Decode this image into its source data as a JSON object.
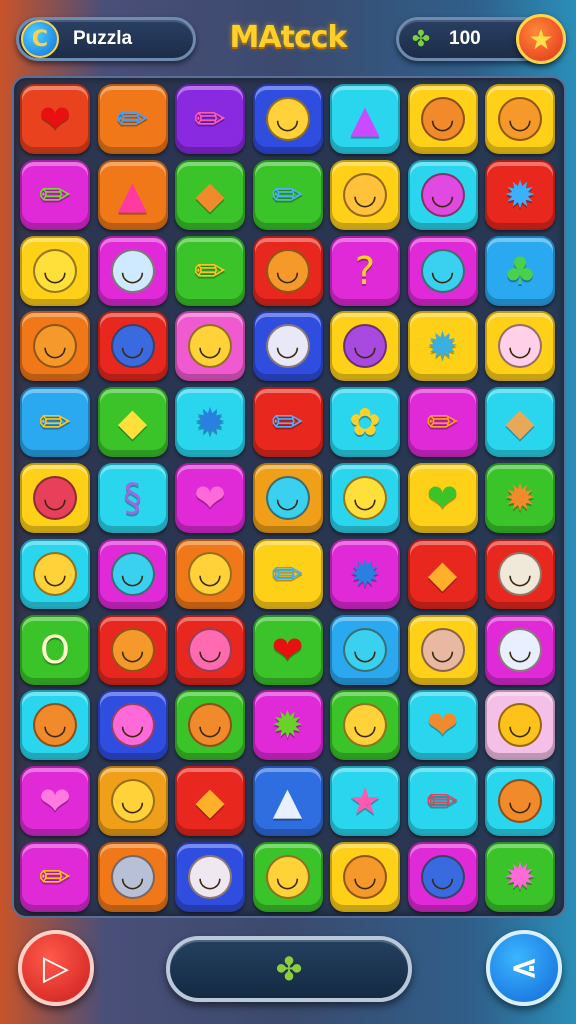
{
  "header": {
    "left_label": "Puzzla",
    "left_icon": "c-coin-icon",
    "title": "MAtcck",
    "score": "100",
    "score_icon": "clover-icon",
    "star_icon": "star-icon"
  },
  "board": {
    "rows": [
      [
        {
          "bg": "#e8421e",
          "icon": "heart-icon",
          "glyph": "❤",
          "color": "#e81010"
        },
        {
          "bg": "#f07818",
          "icon": "pencil-icon",
          "glyph": "✏",
          "color": "#3fa0ff"
        },
        {
          "bg": "#8a2ae0",
          "icon": "pencil-icon",
          "glyph": "✏",
          "color": "#ff5ab0"
        },
        {
          "bg": "#2f4ee0",
          "icon": "smiley-face-icon",
          "face": true,
          "faceColor": "#ffd23a",
          "glyph": "◡"
        },
        {
          "bg": "#2ad6ee",
          "icon": "triangle-icon",
          "glyph": "▲",
          "color": "#c94aff"
        },
        {
          "bg": "#ffd018",
          "icon": "cat-face-icon",
          "face": true,
          "faceColor": "#f08a2a",
          "glyph": "◡"
        },
        {
          "bg": "#ffd018",
          "icon": "cat-face-icon",
          "face": true,
          "faceColor": "#f59a2a",
          "glyph": "◡"
        }
      ],
      [
        {
          "bg": "#e02ad8",
          "icon": "pencil-icon",
          "glyph": "✏",
          "color": "#7ad33a"
        },
        {
          "bg": "#f07818",
          "icon": "drop-icon",
          "glyph": "▲",
          "color": "#ff3aa0"
        },
        {
          "bg": "#3ac42a",
          "icon": "leaf-icon",
          "glyph": "◆",
          "color": "#f08a2a"
        },
        {
          "bg": "#3ac42a",
          "icon": "pencil-icon",
          "glyph": "✏",
          "color": "#4ab0ff"
        },
        {
          "bg": "#ffd018",
          "icon": "bear-face-icon",
          "face": true,
          "faceColor": "#ffc23a",
          "glyph": "◡"
        },
        {
          "bg": "#2ad6ee",
          "icon": "monster-face-icon",
          "face": true,
          "faceColor": "#e04ae0",
          "glyph": "◡"
        },
        {
          "bg": "#e8281e",
          "icon": "splat-icon",
          "glyph": "✹",
          "color": "#3ab0ff"
        }
      ],
      [
        {
          "bg": "#ffd018",
          "icon": "lemon-face-icon",
          "face": true,
          "faceColor": "#ffe03a",
          "glyph": "◡"
        },
        {
          "bg": "#e02ad8",
          "icon": "egg-face-icon",
          "face": true,
          "faceColor": "#cfeaff",
          "glyph": "◡"
        },
        {
          "bg": "#3ac42a",
          "icon": "pencil-icon",
          "glyph": "✏",
          "color": "#ffc21a"
        },
        {
          "bg": "#e8281e",
          "icon": "cat-face-icon",
          "face": true,
          "faceColor": "#f59a2a",
          "glyph": "◡"
        },
        {
          "bg": "#e02ad8",
          "icon": "question-icon",
          "glyph": "?",
          "color": "#ffd02a"
        },
        {
          "bg": "#e02ad8",
          "icon": "smiley-face-icon",
          "face": true,
          "faceColor": "#3ad0f0",
          "glyph": "◡"
        },
        {
          "bg": "#2aa8f0",
          "icon": "leaf-icon",
          "glyph": "♣",
          "color": "#4ad04a"
        }
      ],
      [
        {
          "bg": "#f07818",
          "icon": "cat-face-icon",
          "face": true,
          "faceColor": "#f59a2a",
          "glyph": "◡"
        },
        {
          "bg": "#e8281e",
          "icon": "blob-face-icon",
          "face": true,
          "faceColor": "#3a6ae0",
          "glyph": "◡"
        },
        {
          "bg": "#f05ad0",
          "icon": "smiley-face-icon",
          "face": true,
          "faceColor": "#ffd23a",
          "glyph": "◡"
        },
        {
          "bg": "#2f4ee0",
          "icon": "sunglasses-face-icon",
          "face": true,
          "faceColor": "#e8e8f8",
          "glyph": "◡"
        },
        {
          "bg": "#ffd018",
          "icon": "cat-face-icon",
          "face": true,
          "faceColor": "#a84ae0",
          "glyph": "◡"
        },
        {
          "bg": "#ffd018",
          "icon": "splat-icon",
          "glyph": "✹",
          "color": "#3ab0e0"
        },
        {
          "bg": "#ffd018",
          "icon": "cat-face-icon",
          "face": true,
          "faceColor": "#ffd0e8",
          "glyph": "◡"
        }
      ],
      [
        {
          "bg": "#2aa8f0",
          "icon": "pencil-icon",
          "glyph": "✏",
          "color": "#ffc21a"
        },
        {
          "bg": "#3ac42a",
          "icon": "leaf-icon",
          "glyph": "◆",
          "color": "#ffe03a"
        },
        {
          "bg": "#2ad6ee",
          "icon": "splat-icon",
          "glyph": "✹",
          "color": "#2a80e0"
        },
        {
          "bg": "#e8281e",
          "icon": "pencil-icon",
          "glyph": "✏",
          "color": "#4ab0ff"
        },
        {
          "bg": "#2ad6ee",
          "icon": "flower-icon",
          "glyph": "✿",
          "color": "#ffd02a"
        },
        {
          "bg": "#e02ad8",
          "icon": "pencil-icon",
          "glyph": "✏",
          "color": "#ffa01a"
        },
        {
          "bg": "#2ad6ee",
          "icon": "sign-icon",
          "glyph": "◆",
          "color": "#e8a85a"
        }
      ],
      [
        {
          "bg": "#ffd018",
          "icon": "monster-face-icon",
          "face": true,
          "faceColor": "#e8405a",
          "glyph": "◡"
        },
        {
          "bg": "#2ad6ee",
          "icon": "scroll-icon",
          "glyph": "§",
          "color": "#9a6ae0"
        },
        {
          "bg": "#e02ad8",
          "icon": "heart-icon",
          "glyph": "❤",
          "color": "#ff6ad8"
        },
        {
          "bg": "#f0a018",
          "icon": "smiley-face-icon",
          "face": true,
          "faceColor": "#3ad0f0",
          "glyph": "◡"
        },
        {
          "bg": "#2ad6ee",
          "icon": "cat-face-icon",
          "face": true,
          "faceColor": "#ffe03a",
          "glyph": "◡"
        },
        {
          "bg": "#ffd018",
          "icon": "heart-icon",
          "glyph": "❤",
          "color": "#3ac42a"
        },
        {
          "bg": "#3ac42a",
          "icon": "splat-icon",
          "glyph": "✹",
          "color": "#f08a2a"
        }
      ],
      [
        {
          "bg": "#2ad6ee",
          "icon": "smiley-face-icon",
          "face": true,
          "faceColor": "#ffd23a",
          "glyph": "◡"
        },
        {
          "bg": "#e02ad8",
          "icon": "smiley-face-icon",
          "face": true,
          "faceColor": "#3ad0f0",
          "glyph": "◡"
        },
        {
          "bg": "#f07818",
          "icon": "smiley-face-icon",
          "face": true,
          "faceColor": "#ffd23a",
          "glyph": "◡"
        },
        {
          "bg": "#ffd018",
          "icon": "pencil-icon",
          "glyph": "✏",
          "color": "#3ab0ff"
        },
        {
          "bg": "#e02ad8",
          "icon": "splat-icon",
          "glyph": "✹",
          "color": "#2a80e0"
        },
        {
          "bg": "#e8281e",
          "icon": "balloon-icon",
          "glyph": "◆",
          "color": "#ffb02a"
        },
        {
          "bg": "#e8281e",
          "icon": "sunglasses-face-icon",
          "face": true,
          "faceColor": "#f0e8d8",
          "glyph": "◡"
        }
      ],
      [
        {
          "bg": "#3ac42a",
          "icon": "ring-icon",
          "glyph": "O",
          "color": "#fff8c8"
        },
        {
          "bg": "#e8281e",
          "icon": "smiley-face-icon",
          "face": true,
          "faceColor": "#f59a2a",
          "glyph": "◡"
        },
        {
          "bg": "#e8281e",
          "icon": "pig-face-icon",
          "face": true,
          "faceColor": "#ff6ab0",
          "glyph": "◡"
        },
        {
          "bg": "#3ac42a",
          "icon": "heart-icon",
          "glyph": "❤",
          "color": "#e81010"
        },
        {
          "bg": "#2aa8f0",
          "icon": "bear-face-icon",
          "face": true,
          "faceColor": "#3ad0f0",
          "glyph": "◡"
        },
        {
          "bg": "#ffd018",
          "icon": "egg-face-icon",
          "face": true,
          "faceColor": "#e8b8a0",
          "glyph": "◡"
        },
        {
          "bg": "#e02ad8",
          "icon": "egg-face-icon",
          "face": true,
          "faceColor": "#e8f0ff",
          "glyph": "◡"
        }
      ],
      [
        {
          "bg": "#2ad6ee",
          "icon": "acorn-face-icon",
          "face": true,
          "faceColor": "#f08a2a",
          "glyph": "◡"
        },
        {
          "bg": "#2f4ee0",
          "icon": "glasses-face-icon",
          "face": true,
          "faceColor": "#ff6ad8",
          "glyph": "◡"
        },
        {
          "bg": "#3ac42a",
          "icon": "smiley-face-icon",
          "face": true,
          "faceColor": "#f08a2a",
          "glyph": "◡"
        },
        {
          "bg": "#e02ad8",
          "icon": "bug-icon",
          "glyph": "✹",
          "color": "#6ad02a"
        },
        {
          "bg": "#3ac42a",
          "icon": "lemon-face-icon",
          "face": true,
          "faceColor": "#ffd23a",
          "glyph": "◡"
        },
        {
          "bg": "#2ad6ee",
          "icon": "heart-face-icon",
          "glyph": "❤",
          "color": "#f08a2a"
        },
        {
          "bg": "#f5c0e8",
          "icon": "sun-face-icon",
          "face": true,
          "faceColor": "#ffc21a",
          "glyph": "◡"
        }
      ],
      [
        {
          "bg": "#e02ad8",
          "icon": "heart-icon",
          "glyph": "❤",
          "color": "#ff7ae0"
        },
        {
          "bg": "#f0a018",
          "icon": "smiley-face-icon",
          "face": true,
          "faceColor": "#ffd23a",
          "glyph": "◡"
        },
        {
          "bg": "#e8281e",
          "icon": "flame-face-icon",
          "glyph": "◆",
          "color": "#ffb02a"
        },
        {
          "bg": "#2f6ee0",
          "icon": "rocket-icon",
          "glyph": "▲",
          "color": "#e8f0ff"
        },
        {
          "bg": "#2ad6ee",
          "icon": "star-icon",
          "glyph": "★",
          "color": "#ff5ab0"
        },
        {
          "bg": "#2ad6ee",
          "icon": "pencil-icon",
          "glyph": "✏",
          "color": "#e8405a"
        },
        {
          "bg": "#2ad6ee",
          "icon": "smiley-face-icon",
          "face": true,
          "faceColor": "#f08a2a",
          "glyph": "◡"
        }
      ],
      [
        {
          "bg": "#e02ad8",
          "icon": "pencil-icon",
          "glyph": "✏",
          "color": "#ffc21a"
        },
        {
          "bg": "#f07818",
          "icon": "smiley-face-icon",
          "face": true,
          "faceColor": "#b8c0d8",
          "glyph": "◡"
        },
        {
          "bg": "#2f4ee0",
          "icon": "boy-face-icon",
          "face": true,
          "faceColor": "#f0e8f0",
          "glyph": "◡"
        },
        {
          "bg": "#3ac42a",
          "icon": "bear-face-icon",
          "face": true,
          "faceColor": "#ffd23a",
          "glyph": "◡"
        },
        {
          "bg": "#ffd018",
          "icon": "bear-face-icon",
          "face": true,
          "faceColor": "#f59a2a",
          "glyph": "◡"
        },
        {
          "bg": "#e02ad8",
          "icon": "monster-face-icon",
          "face": true,
          "faceColor": "#3a6ae0",
          "glyph": "◡"
        },
        {
          "bg": "#3ac42a",
          "icon": "splat-icon",
          "glyph": "✹",
          "color": "#ff6ad8"
        }
      ]
    ]
  },
  "footer": {
    "play_icon": "play-icon",
    "center_icon": "clover-icon",
    "share_icon": "share-icon"
  }
}
